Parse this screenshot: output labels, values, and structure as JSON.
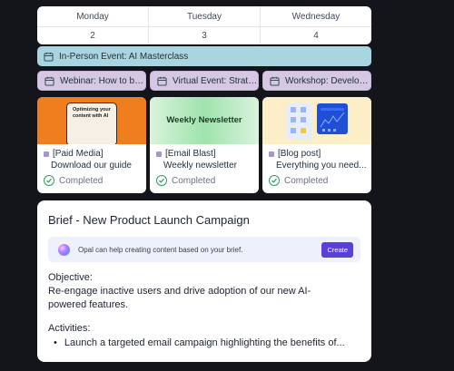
{
  "calendar": {
    "days": [
      {
        "name": "Monday",
        "date": "2"
      },
      {
        "name": "Tuesday",
        "date": "3"
      },
      {
        "name": "Wednesday",
        "date": "4"
      }
    ]
  },
  "events": {
    "full_width": "In-Person Event: AI Masterclass",
    "row": [
      "Webinar: How to bui...",
      "Virtual Event: Strate...",
      "Workshop: Developi..."
    ]
  },
  "cards": [
    {
      "tag": "[Paid Media]",
      "title": "Download our guide",
      "status": "Completed",
      "thumb_text": "Optimizing your content with AI"
    },
    {
      "tag": "[Email Blast]",
      "title": "Weekly newsletter",
      "status": "Completed",
      "thumb_text": "Weekly Newsletter"
    },
    {
      "tag": "[Blog post]",
      "title": "Everything you need...",
      "status": "Completed"
    }
  ],
  "brief": {
    "title": "Brief - New Product Launch Campaign",
    "opal_text": "Opal can help creating content based on your brief.",
    "create_label": "Create",
    "objective_label": "Objective:",
    "objective_text": "Re-engage inactive users and drive adoption of our new AI-powered features.",
    "activities_label": "Activities:",
    "activities": [
      "Launch a targeted email campaign highlighting the benefits of..."
    ]
  },
  "colors": {
    "background": "#14151a",
    "event_teal": "#a8d5df",
    "event_lavender": "#d4c8e3",
    "completed_green": "#2e9b5c",
    "create_button": "#5a3fd9"
  }
}
